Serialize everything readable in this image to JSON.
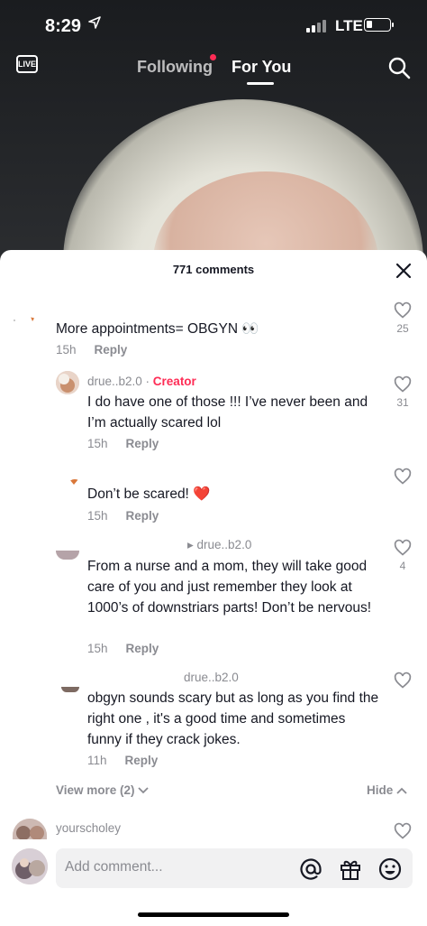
{
  "status": {
    "time": "8:29",
    "network": "LTE"
  },
  "topnav": {
    "live_label": "LIVE",
    "tabs": [
      "Following",
      "For You"
    ],
    "active_tab": "For You"
  },
  "comments_sheet": {
    "title": "771 comments",
    "comments": [
      {
        "text": "More appointments= OBGYN 👀",
        "time": "15h",
        "reply": "Reply",
        "likes": "25"
      },
      {
        "user": "drue..b2.0",
        "badge": "Creator",
        "text": "I do have one of those !!! I’ve never been and I’m actually scared lol",
        "time": "15h",
        "reply": "Reply",
        "likes": "31"
      },
      {
        "text": "Don’t be scared! ❤️",
        "time": "15h",
        "reply": "Reply",
        "likes": ""
      },
      {
        "user": "▸ drue..b2.0",
        "text": "From a nurse and a mom, they will take good care of you and just remember they look at 1000’s of downstriars parts! Don’t be nervous!",
        "time": "15h",
        "reply": "Reply",
        "likes": "4"
      },
      {
        "user": "drue..b2.0",
        "text": "obgyn sounds scary but as long as you find the right one , it's a good time and sometimes funny if they crack jokes.",
        "time": "11h",
        "reply": "Reply",
        "likes": ""
      }
    ],
    "view_more": "View more (2)",
    "hide": "Hide",
    "next_user": "yourscholey"
  },
  "composer": {
    "placeholder": "Add comment..."
  },
  "colors": {
    "accent": "#fe2c55",
    "text": "#161823",
    "muted": "#8a8b91",
    "input_bg": "#f1f1f2"
  }
}
